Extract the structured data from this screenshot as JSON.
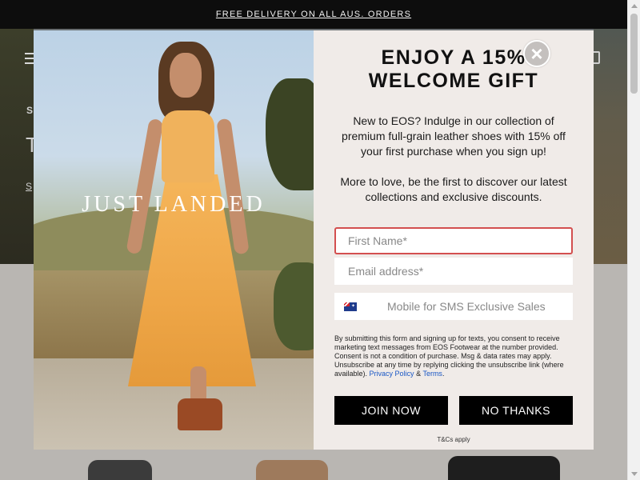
{
  "announcement": {
    "text": "FREE DELIVERY ON ALL AUS. ORDERS"
  },
  "hero": {
    "subtitle": "S",
    "heading": "T",
    "link": "S"
  },
  "modal": {
    "image_text": "JUST LANDED",
    "title": "ENJOY A 15%\nWELCOME GIFT",
    "intro": "New to EOS? Indulge in our collection of premium full-grain leather shoes with 15% off your first purchase when you sign up!",
    "intro2": "More to love, be the first to discover our latest collections and exclusive discounts.",
    "first_name_placeholder": "First Name*",
    "email_placeholder": "Email address*",
    "phone_placeholder": "Mobile for SMS Exclusive Sales",
    "phone_country": "AU",
    "legal": "By submitting this form and signing up for texts, you consent to receive marketing text messages from EOS Footwear at the number provided. Consent is not a condition of purchase. Msg & data rates may apply. Unsubscribe at any time by replying clicking the unsubscribe link (where available).",
    "privacy_link": "Privacy Policy",
    "amp": "&",
    "terms_link": "Terms",
    "period": ".",
    "join_label": "JOIN NOW",
    "no_thanks_label": "NO THANKS",
    "tcs": "T&Cs apply",
    "close_symbol": "×"
  },
  "colors": {
    "accent_border": "#d34f4f",
    "button_bg": "#000000",
    "modal_bg": "#f0ebe8",
    "link": "#1a57c5"
  }
}
